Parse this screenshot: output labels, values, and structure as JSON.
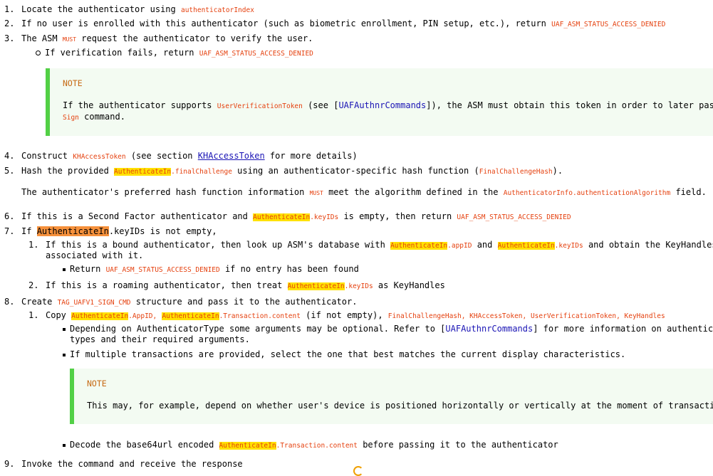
{
  "items": {
    "i1": {
      "num": "1.",
      "pre": "Locate the authenticator using ",
      "code": "authenticatorIndex"
    },
    "i2": {
      "num": "2.",
      "pre": "If no user is enrolled with this authenticator (such as biometric enrollment, PIN setup, etc.), return ",
      "code": "UAF_ASM_STATUS_ACCESS_DENIED"
    },
    "i3": {
      "num": "3.",
      "pre": "The ASM ",
      "must": "MUST",
      "post": " request the authenticator to verify the user."
    },
    "i3a": {
      "pre": "If verification fails, return ",
      "code": "UAF_ASM_STATUS_ACCESS_DENIED"
    },
    "note1": {
      "label": "NOTE",
      "pre": "If the authenticator supports ",
      "code": "UserVerificationToken",
      "mid": " (see [",
      "ref": "UAFAuthnrCommands",
      "post": "]), the ASM must obtain this token in order to later pass to",
      "line2code": "Sign",
      "line2post": " command."
    },
    "i4": {
      "num": "4.",
      "pre": "Construct ",
      "code": "KHAccessToken",
      "mid": " (see section ",
      "link": "KHAccessToken",
      "post": " for more details)"
    },
    "i5": {
      "num": "5.",
      "pre": "Hash the provided ",
      "hl": "AuthenticateIn",
      "code": ".finalChallenge",
      "mid": " using an authenticator-specific hash function (",
      "code2": "FinalChallengeHash",
      "post": ")."
    },
    "i5p": {
      "pre": "The authenticator's preferred hash function information ",
      "must": "MUST",
      "mid": " meet the algorithm defined in the ",
      "code": "AuthenticatorInfo.authenticationAlgorithm",
      "post": " field."
    },
    "i6": {
      "num": "6.",
      "pre": "If this is a Second Factor authenticator and ",
      "hl": "AuthenticateIn",
      "code": ".keyIDs",
      "mid": " is empty, then return ",
      "code2": "UAF_ASM_STATUS_ACCESS_DENIED"
    },
    "i7": {
      "num": "7.",
      "pre": "If ",
      "hl": "AuthenticateIn",
      "post": ".keyIDs is not empty,"
    },
    "i7a": {
      "num": "1.",
      "pre": "If this is a bound authenticator, then look up ASM's database with ",
      "hl": "AuthenticateIn",
      "code": ".appID",
      "mid": " and ",
      "hl2": "AuthenticateIn",
      "code2": ".keyIDs",
      "post": " and obtain the KeyHandles",
      "line2": "associated with it."
    },
    "i7a1": {
      "pre": "Return ",
      "code": "UAF_ASM_STATUS_ACCESS_DENIED",
      "post": " if no entry has been found"
    },
    "i7b": {
      "num": "2.",
      "pre": "If this is a roaming authenticator, then treat ",
      "hl": "AuthenticateIn",
      "code": ".keyIDs",
      "post": " as KeyHandles"
    },
    "i8": {
      "num": "8.",
      "pre": "Create ",
      "code": "TAG_UAFV1_SIGN_CMD",
      "post": " structure and pass it to the authenticator."
    },
    "i8a": {
      "num": "1.",
      "pre": "Copy ",
      "hl": "AuthenticateIn",
      "code": ".AppID,",
      "hl2": "AuthenticateIn",
      "code2": ".Transaction.content",
      "mid": " (if not empty), ",
      "code3": "FinalChallengeHash, KHAccessToken, UserVerificationToken, KeyHandles"
    },
    "i8a1": {
      "pre": "Depending on AuthenticatorType some arguments may be optional. Refer to [",
      "ref": "UAFAuthnrCommands",
      "post": "] for more information on authenticator",
      "line2": "types and their required arguments."
    },
    "i8a2": {
      "text": "If multiple transactions are provided, select the one that best matches the current display characteristics."
    },
    "note2": {
      "label": "NOTE",
      "text": "This may, for example, depend on whether user's device is positioned horizontally or vertically at the moment of transaction."
    },
    "i8a3": {
      "pre": "Decode the base64url encoded ",
      "hl": "AuthenticateIn",
      "code": ".Transaction.content",
      "post": " before passing it to the authenticator"
    },
    "i9": {
      "num": "9.",
      "text": "Invoke the command and receive the response"
    }
  },
  "colors": {
    "code": "#e5410f",
    "highlight": "#ffe100",
    "highlight_orange": "#f6913c",
    "note_border": "#52d046",
    "link": "#1a14b5"
  }
}
